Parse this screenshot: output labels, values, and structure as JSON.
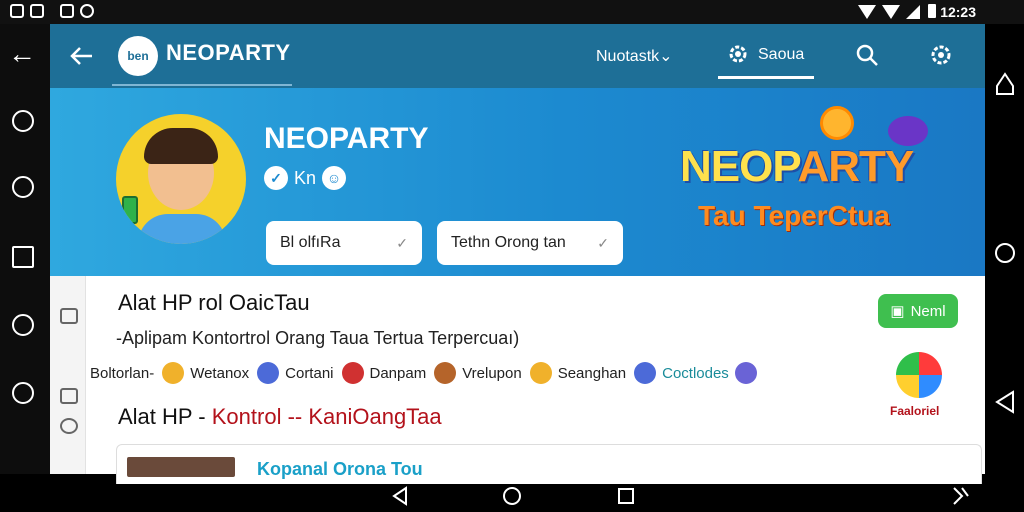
{
  "status_bar": {
    "time": "12:23"
  },
  "app_bar": {
    "logo_text": "ben",
    "app_name": "NEOPARTY",
    "tab_1_label": "Nuotastk⌄",
    "tab_2_label": "Saoua"
  },
  "hero": {
    "title": "NEOPARTY",
    "badge_text": "Kn",
    "pill_1_label": "Bl olfıRa",
    "pill_2_label": "Tethn Orong tan",
    "logo_big_a": "NEOP",
    "logo_big_b": "ARTY",
    "logo_sub": "Tau TeperCtua"
  },
  "content": {
    "heading_1": "Alat HP rol OaicTau",
    "subtitle": "-Aplipam Kontortrol Orang Taua Tertua Terpercuaı)",
    "new_badge": "Neml",
    "chips": [
      {
        "label": "Boltorlan-",
        "color": "#f0b12b"
      },
      {
        "label": "Wetanox",
        "color": "#4c6ad8"
      },
      {
        "label": "Cortani",
        "color": "#d03131"
      },
      {
        "label": "Danpam",
        "color": "#b5642a"
      },
      {
        "label": "Vrelupon",
        "color": "#f0b12b"
      },
      {
        "label": "Seanghan",
        "color": "#4c6ad8"
      },
      {
        "label": "Coctlodes",
        "color": "#6a63d6"
      }
    ],
    "heading_2_a": "Alat HP - ",
    "heading_2_b": "Kontrol -- KaniOangTaa",
    "app_logo_caption": "Faaloriel",
    "card_title": "Kopanal Orona Tou"
  },
  "colors": {
    "app_bar": "#1e6f97",
    "hero_gradient_start": "#2fa8df",
    "hero_gradient_end": "#1a78c4",
    "new_badge": "#3fbf4f",
    "accent_red": "#b3121b"
  }
}
